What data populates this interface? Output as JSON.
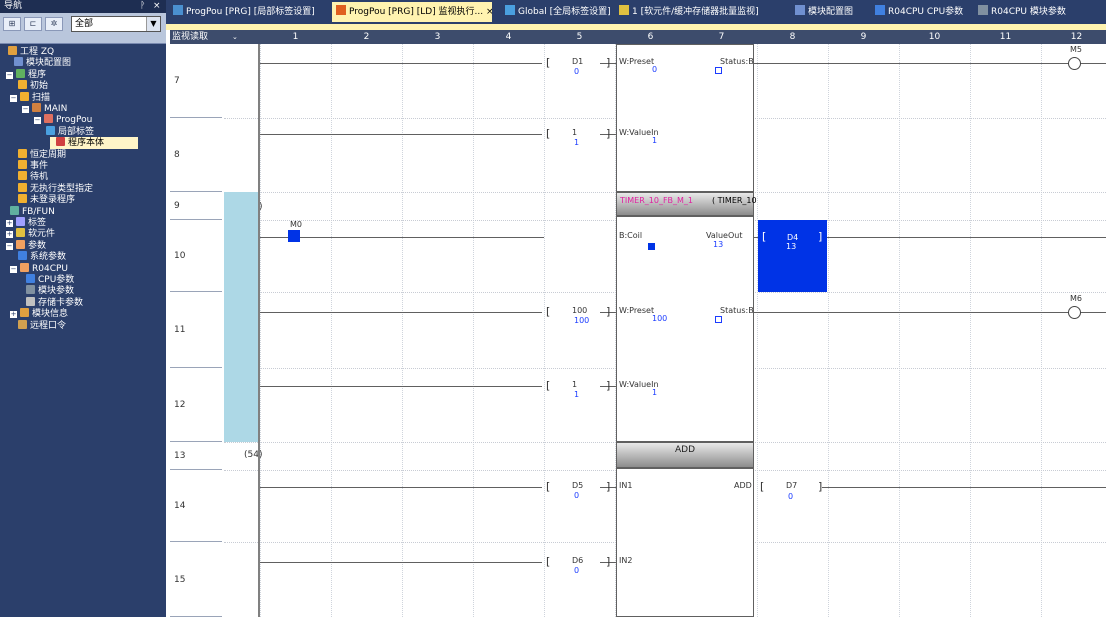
{
  "nav": {
    "title": "导航",
    "pin": "ᚹ",
    "close": "×",
    "toolbar": {
      "btn1": "⊞",
      "btn2": "⊏",
      "btn3": "✲",
      "scope_selected": "全部"
    },
    "tree": [
      {
        "label": "工程 ZQ",
        "icon": "project-icon"
      },
      {
        "label": "模块配置图",
        "icon": "module-config-icon"
      },
      {
        "label": "程序",
        "icon": "program-folder-icon",
        "expander": "−"
      },
      {
        "label": "初始",
        "icon": "folder-icon"
      },
      {
        "label": "扫描",
        "icon": "folder-icon",
        "expander": "−"
      },
      {
        "label": "MAIN",
        "icon": "task-icon",
        "expander": "−"
      },
      {
        "label": "ProgPou",
        "icon": "program-icon",
        "expander": "−"
      },
      {
        "label": "局部标签",
        "icon": "local-label-icon"
      },
      {
        "label": "程序本体",
        "icon": "program-body-icon",
        "selected": true
      },
      {
        "label": "恒定周期",
        "icon": "folder-icon"
      },
      {
        "label": "事件",
        "icon": "folder-icon"
      },
      {
        "label": "待机",
        "icon": "folder-icon"
      },
      {
        "label": "无执行类型指定",
        "icon": "folder-icon"
      },
      {
        "label": "未登录程序",
        "icon": "folder-icon"
      },
      {
        "label": "FB/FUN",
        "icon": "fb-icon"
      },
      {
        "label": "标签",
        "icon": "label-icon",
        "expander": "+"
      },
      {
        "label": "软元件",
        "icon": "device-icon",
        "expander": "+"
      },
      {
        "label": "参数",
        "icon": "parameter-icon",
        "expander": "−"
      },
      {
        "label": "系统参数",
        "icon": "system-param-icon"
      },
      {
        "label": "R04CPU",
        "icon": "cpu-icon",
        "expander": "−"
      },
      {
        "label": "CPU参数",
        "icon": "cpu-param-icon"
      },
      {
        "label": "模块参数",
        "icon": "module-param-icon"
      },
      {
        "label": "存储卡参数",
        "icon": "memory-card-icon"
      },
      {
        "label": "模块信息",
        "icon": "module-info-icon",
        "expander": "+"
      },
      {
        "label": "远程口令",
        "icon": "remote-password-icon"
      }
    ]
  },
  "tabs": [
    {
      "label": "ProgPou [PRG] [局部标签设置]",
      "active": false
    },
    {
      "label": "ProgPou [PRG] [LD] 监视执行... ×",
      "active": true
    },
    {
      "label": "Global [全局标签设置]",
      "active": false
    },
    {
      "label": "1 [软元件/缓冲存储器批量监视]",
      "active": false
    },
    {
      "label": "模块配置图",
      "active": false
    },
    {
      "label": "R04CPU CPU参数",
      "active": false
    },
    {
      "label": "R04CPU 模块参数",
      "active": false
    }
  ],
  "ladder": {
    "monitor_label": "监视读取",
    "monitor_dd": "⌄",
    "columns": [
      "1",
      "2",
      "3",
      "4",
      "5",
      "6",
      "7",
      "8",
      "9",
      "10",
      "11",
      "12"
    ],
    "steps": [
      "7",
      "8",
      "9",
      "10",
      "11",
      "12",
      "13",
      "14",
      "15"
    ],
    "step_values": {
      "s9": "(31)",
      "s13": "(54)"
    },
    "contact_m0": "M0",
    "coil_m5": "M5",
    "coil_m6": "M6",
    "rung7": {
      "dev": "D1",
      "dev_val": "0",
      "pin": "W:Preset",
      "pin_val": "0",
      "out": "Status:B"
    },
    "rung8": {
      "dev": "1",
      "dev_val": "1",
      "pin": "W:ValueIn",
      "pin_val": "1"
    },
    "rung9": {
      "instance": "TIMER_10_FB_M_1",
      "type": "( TIMER_10"
    },
    "rung10": {
      "pin": "B:Coil",
      "out": "ValueOut",
      "out_val": "13",
      "dev": "D4",
      "dev_val": "13"
    },
    "rung11": {
      "dev": "100",
      "dev_val": "100",
      "pin": "W:Preset",
      "pin_val": "100",
      "out": "Status:B"
    },
    "rung12": {
      "dev": "1",
      "dev_val": "1",
      "pin": "W:ValueIn",
      "pin_val": "1"
    },
    "add": {
      "title": "ADD",
      "in1": "IN1",
      "in2": "IN2",
      "out": "ADD",
      "d5": "D5",
      "d5_val": "0",
      "d6": "D6",
      "d6_val": "0",
      "d7": "D7",
      "d7_val": "0"
    },
    "brackets": {
      "open": "[",
      "close": "]"
    }
  }
}
